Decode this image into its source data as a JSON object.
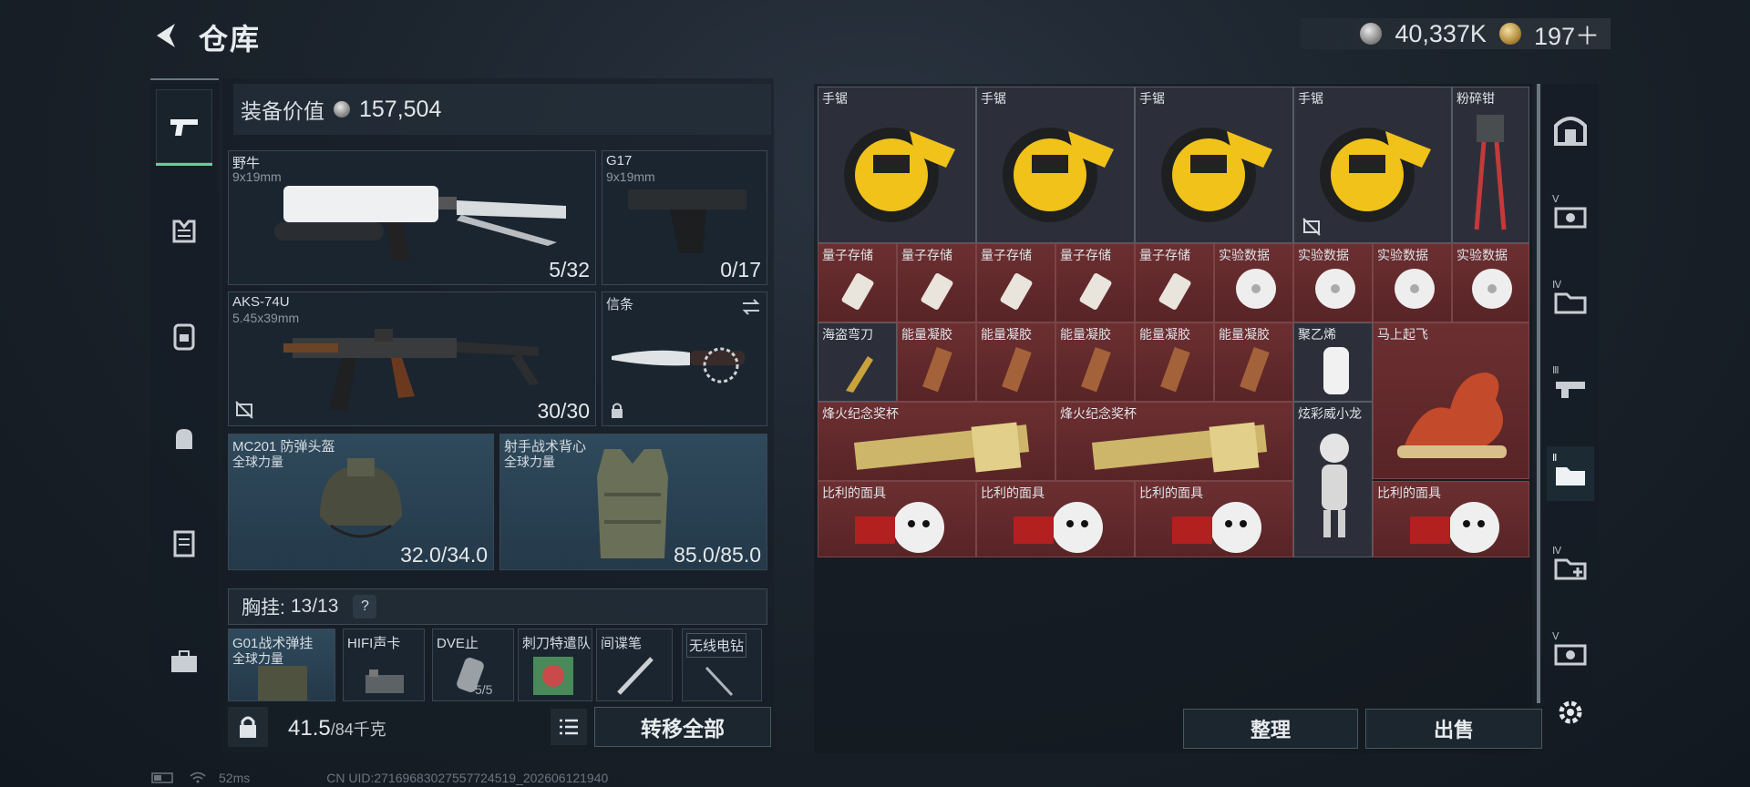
{
  "header": {
    "title": "仓库"
  },
  "currency": [
    {
      "icon": "silver-coin-icon",
      "value": "40,337K"
    },
    {
      "icon": "gold-coin-icon",
      "value": "197＋"
    }
  ],
  "equipment": {
    "value_label": "装备价值",
    "value": "157,504",
    "slots": {
      "primary": {
        "name": "野牛",
        "caliber": "9x19mm",
        "ammo": "5/32"
      },
      "pistol": {
        "name": "G17",
        "caliber": "9x19mm",
        "ammo": "0/17"
      },
      "secondary": {
        "name": "AKS-74U",
        "caliber": "5.45x39mm",
        "ammo": "30/30"
      },
      "melee": {
        "name": "信条"
      },
      "helmet": {
        "name": "MC201 防弹头盔",
        "sub": "全球力量",
        "durability": "32.0/34.0"
      },
      "armor": {
        "name": "射手战术背心",
        "sub": "全球力量",
        "durability": "85.0/85.0"
      }
    },
    "chest_rig_label": "胸挂:",
    "chest_rig_count": "13/13",
    "chest_rig_help": "?",
    "chest_items": [
      {
        "name": "G01战术弹挂",
        "sub": "全球力量"
      },
      {
        "name": "HIFI声卡",
        "sub": ""
      },
      {
        "name": "DVE止",
        "sub": "5/5"
      },
      {
        "name": "刺刀特遣队",
        "sub": ""
      },
      {
        "name": "间谍笔",
        "sub": ""
      },
      {
        "name": "无线电钻",
        "sub": ""
      }
    ],
    "weight_value": "41.5",
    "weight_max": "/84千克",
    "transfer_all": "转移全部"
  },
  "stash": {
    "items": [
      {
        "name": "手锯",
        "icon": "circular-saw-icon"
      },
      {
        "name": "手锯",
        "icon": "circular-saw-icon"
      },
      {
        "name": "手锯",
        "icon": "circular-saw-icon"
      },
      {
        "name": "手锯",
        "icon": "circular-saw-icon"
      },
      {
        "name": "粉碎钳",
        "icon": "pipe-wrench-icon"
      },
      {
        "name": "量子存储",
        "icon": "usb-drive-icon"
      },
      {
        "name": "量子存储",
        "icon": "usb-drive-icon"
      },
      {
        "name": "量子存储",
        "icon": "usb-drive-icon"
      },
      {
        "name": "量子存储",
        "icon": "usb-drive-icon"
      },
      {
        "name": "量子存储",
        "icon": "usb-drive-icon"
      },
      {
        "name": "实验数据",
        "icon": "disc-icon"
      },
      {
        "name": "实验数据",
        "icon": "disc-icon"
      },
      {
        "name": "实验数据",
        "icon": "disc-icon"
      },
      {
        "name": "实验数据",
        "icon": "disc-icon"
      },
      {
        "name": "海盗弯刀",
        "icon": "machete-icon"
      },
      {
        "name": "能量凝胶",
        "icon": "gel-pack-icon"
      },
      {
        "name": "能量凝胶",
        "icon": "gel-pack-icon"
      },
      {
        "name": "能量凝胶",
        "icon": "gel-pack-icon"
      },
      {
        "name": "能量凝胶",
        "icon": "gel-pack-icon"
      },
      {
        "name": "能量凝胶",
        "icon": "gel-pack-icon"
      },
      {
        "name": "聚乙烯",
        "icon": "roll-icon"
      },
      {
        "name": "马上起飞",
        "icon": "horse-statue-icon"
      },
      {
        "name": "烽火纪念奖杯",
        "icon": "trophy-icon"
      },
      {
        "name": "烽火纪念奖杯",
        "icon": "trophy-icon"
      },
      {
        "name": "炫彩威小龙",
        "icon": "figurine-icon"
      },
      {
        "name": "比利的面具",
        "icon": "puppet-mask-icon"
      },
      {
        "name": "比利的面具",
        "icon": "puppet-mask-icon"
      },
      {
        "name": "比利的面具",
        "icon": "puppet-mask-icon"
      },
      {
        "name": "比利的面具",
        "icon": "puppet-mask-icon"
      }
    ],
    "sort_label": "整理",
    "sell_label": "出售"
  },
  "right_rail": [
    "Ⅴ",
    "Ⅳ",
    "Ⅲ",
    "Ⅱ",
    "Ⅳ",
    "Ⅴ"
  ],
  "status": {
    "ping": "52ms",
    "uid": "CN UID:2716968302755772451​9_202606121940"
  },
  "colors": {
    "accent_green": "#5fd39a",
    "red_item": "#6c2f31",
    "blue_slot": "#2f4a5c"
  }
}
